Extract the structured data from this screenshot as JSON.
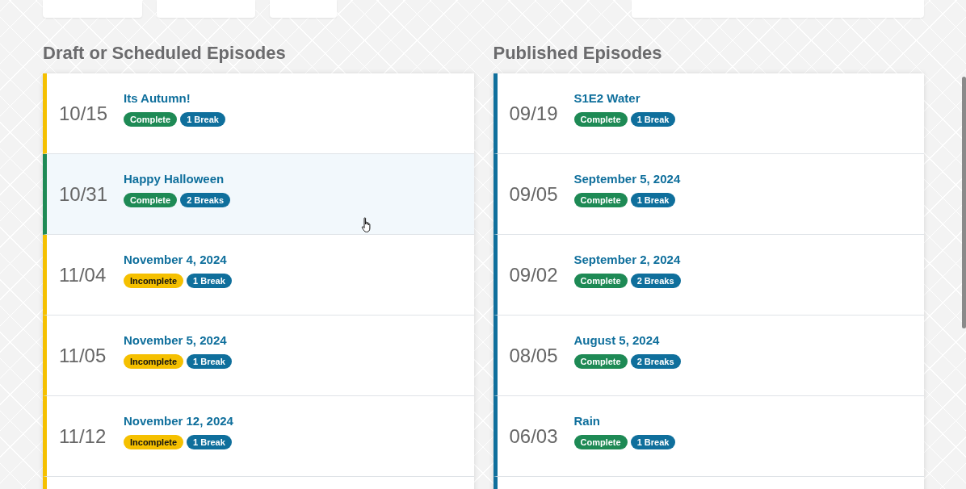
{
  "columns": [
    {
      "title": "Draft or Scheduled Episodes",
      "episodes": [
        {
          "date": "10/15",
          "title": "Its Autumn!",
          "color": "#f5c000",
          "hovered": false,
          "badges": [
            {
              "kind": "complete",
              "label": "Complete"
            },
            {
              "kind": "breaks",
              "label": "1 Break"
            }
          ]
        },
        {
          "date": "10/31",
          "title": "Happy Halloween",
          "color": "#1e8a55",
          "hovered": true,
          "badges": [
            {
              "kind": "complete",
              "label": "Complete"
            },
            {
              "kind": "breaks",
              "label": "2 Breaks"
            }
          ]
        },
        {
          "date": "11/04",
          "title": "November 4, 2024",
          "color": "#f5c000",
          "hovered": false,
          "badges": [
            {
              "kind": "incomplete",
              "label": "Incomplete"
            },
            {
              "kind": "breaks",
              "label": "1 Break"
            }
          ]
        },
        {
          "date": "11/05",
          "title": "November 5, 2024",
          "color": "#f5c000",
          "hovered": false,
          "badges": [
            {
              "kind": "incomplete",
              "label": "Incomplete"
            },
            {
              "kind": "breaks",
              "label": "1 Break"
            }
          ]
        },
        {
          "date": "11/12",
          "title": "November 12, 2024",
          "color": "#f5c000",
          "hovered": false,
          "badges": [
            {
              "kind": "incomplete",
              "label": "Incomplete"
            },
            {
              "kind": "breaks",
              "label": "1 Break"
            }
          ]
        }
      ]
    },
    {
      "title": "Published Episodes",
      "episodes": [
        {
          "date": "09/19",
          "title": "S1E2 Water",
          "color": "#0f6f9c",
          "hovered": false,
          "badges": [
            {
              "kind": "complete",
              "label": "Complete"
            },
            {
              "kind": "breaks",
              "label": "1 Break"
            }
          ]
        },
        {
          "date": "09/05",
          "title": "September 5, 2024",
          "color": "#0f6f9c",
          "hovered": false,
          "badges": [
            {
              "kind": "complete",
              "label": "Complete"
            },
            {
              "kind": "breaks",
              "label": "1 Break"
            }
          ]
        },
        {
          "date": "09/02",
          "title": "September 2, 2024",
          "color": "#0f6f9c",
          "hovered": false,
          "badges": [
            {
              "kind": "complete",
              "label": "Complete"
            },
            {
              "kind": "breaks",
              "label": "2 Breaks"
            }
          ]
        },
        {
          "date": "08/05",
          "title": "August 5, 2024",
          "color": "#0f6f9c",
          "hovered": false,
          "badges": [
            {
              "kind": "complete",
              "label": "Complete"
            },
            {
              "kind": "breaks",
              "label": "2 Breaks"
            }
          ]
        },
        {
          "date": "06/03",
          "title": "Rain",
          "color": "#0f6f9c",
          "hovered": false,
          "badges": [
            {
              "kind": "complete",
              "label": "Complete"
            },
            {
              "kind": "breaks",
              "label": "1 Break"
            }
          ]
        }
      ]
    }
  ]
}
